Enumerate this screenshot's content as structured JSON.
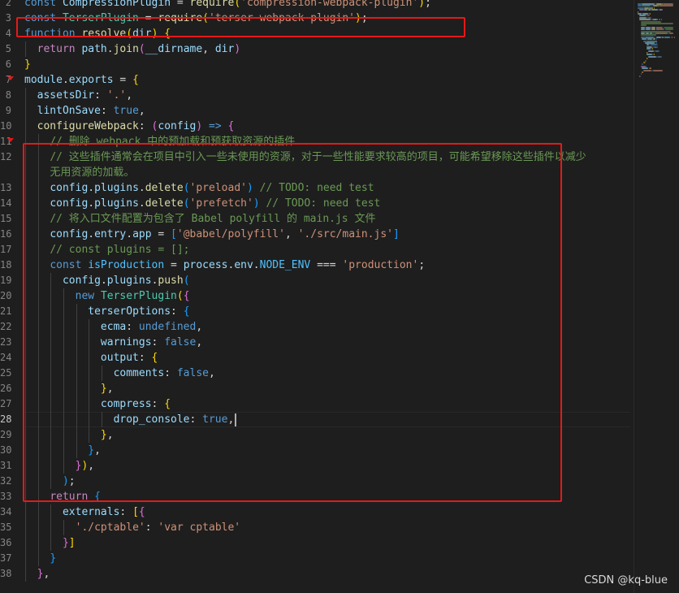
{
  "editor": {
    "lines": [
      {
        "n": "2",
        "tokens": [
          [
            "kw",
            "const "
          ],
          [
            "var",
            "CompressionPlugin"
          ],
          [
            "pl",
            " = "
          ],
          [
            "fn",
            "require"
          ],
          [
            "br1",
            "("
          ],
          [
            "str",
            "'compression-webpack-plugin'"
          ],
          [
            "br1",
            ")"
          ],
          [
            "pl",
            ";"
          ]
        ]
      },
      {
        "n": "3",
        "tokens": [
          [
            "kw",
            "const "
          ],
          [
            "cls",
            "TerserPlugin"
          ],
          [
            "pl",
            " = "
          ],
          [
            "fn",
            "require"
          ],
          [
            "br1",
            "("
          ],
          [
            "str",
            "'terser-webpack-plugin'"
          ],
          [
            "br1",
            ")"
          ],
          [
            "pl",
            ";"
          ]
        ]
      },
      {
        "n": "4",
        "tokens": [
          [
            "kw",
            "function "
          ],
          [
            "fn",
            "resolve"
          ],
          [
            "br1",
            "("
          ],
          [
            "var",
            "dir"
          ],
          [
            "br1",
            ")"
          ],
          [
            "pl",
            " "
          ],
          [
            "br1",
            "{"
          ]
        ]
      },
      {
        "n": "5",
        "tokens": [
          [
            "pl",
            "  "
          ],
          [
            "ctl",
            "return "
          ],
          [
            "var",
            "path"
          ],
          [
            "pl",
            "."
          ],
          [
            "fn",
            "join"
          ],
          [
            "br2",
            "("
          ],
          [
            "var",
            "__dirname"
          ],
          [
            "pl",
            ", "
          ],
          [
            "var",
            "dir"
          ],
          [
            "br2",
            ")"
          ]
        ]
      },
      {
        "n": "6",
        "tokens": [
          [
            "br1",
            "}"
          ]
        ]
      },
      {
        "n": "7",
        "tokens": [
          [
            "var",
            "module"
          ],
          [
            "pl",
            "."
          ],
          [
            "var",
            "exports"
          ],
          [
            "pl",
            " = "
          ],
          [
            "br1",
            "{"
          ]
        ]
      },
      {
        "n": "8",
        "tokens": [
          [
            "pl",
            "  "
          ],
          [
            "var",
            "assetsDir"
          ],
          [
            "pl",
            ": "
          ],
          [
            "str",
            "'.'"
          ],
          [
            "pl",
            ","
          ]
        ]
      },
      {
        "n": "9",
        "tokens": [
          [
            "pl",
            "  "
          ],
          [
            "var",
            "lintOnSave"
          ],
          [
            "pl",
            ": "
          ],
          [
            "kw",
            "true"
          ],
          [
            "pl",
            ","
          ]
        ]
      },
      {
        "n": "10",
        "tokens": [
          [
            "pl",
            "  "
          ],
          [
            "fn",
            "configureWebpack"
          ],
          [
            "pl",
            ": "
          ],
          [
            "br2",
            "("
          ],
          [
            "var",
            "config"
          ],
          [
            "br2",
            ")"
          ],
          [
            "pl",
            " "
          ],
          [
            "kw",
            "=>"
          ],
          [
            "pl",
            " "
          ],
          [
            "br2",
            "{"
          ]
        ]
      },
      {
        "n": "11",
        "tokens": [
          [
            "pl",
            "    "
          ],
          [
            "com",
            "// 删除 webpack 中的预加载和预获取资源的插件"
          ]
        ]
      },
      {
        "n": "12",
        "tokens": [
          [
            "pl",
            "    "
          ],
          [
            "com",
            "// 这些插件通常会在项目中引入一些未使用的资源，对于一些性能要求较高的项目，可能希望移除这些插件以减少"
          ]
        ]
      },
      {
        "n": "",
        "tokens": [
          [
            "pl",
            "    "
          ],
          [
            "com",
            "无用资源的加载。"
          ]
        ]
      },
      {
        "n": "13",
        "tokens": [
          [
            "pl",
            "    "
          ],
          [
            "var",
            "config"
          ],
          [
            "pl",
            "."
          ],
          [
            "var",
            "plugins"
          ],
          [
            "pl",
            "."
          ],
          [
            "fn",
            "delete"
          ],
          [
            "br3",
            "("
          ],
          [
            "str",
            "'preload'"
          ],
          [
            "br3",
            ")"
          ],
          [
            "pl",
            " "
          ],
          [
            "com",
            "// TODO: need test"
          ]
        ]
      },
      {
        "n": "14",
        "tokens": [
          [
            "pl",
            "    "
          ],
          [
            "var",
            "config"
          ],
          [
            "pl",
            "."
          ],
          [
            "var",
            "plugins"
          ],
          [
            "pl",
            "."
          ],
          [
            "fn",
            "delete"
          ],
          [
            "br3",
            "("
          ],
          [
            "str",
            "'prefetch'"
          ],
          [
            "br3",
            ")"
          ],
          [
            "pl",
            " "
          ],
          [
            "com",
            "// TODO: need test"
          ]
        ]
      },
      {
        "n": "15",
        "tokens": [
          [
            "pl",
            "    "
          ],
          [
            "com",
            "// 将入口文件配置为包含了 Babel polyfill 的 main.js 文件"
          ]
        ]
      },
      {
        "n": "16",
        "tokens": [
          [
            "pl",
            "    "
          ],
          [
            "var",
            "config"
          ],
          [
            "pl",
            "."
          ],
          [
            "var",
            "entry"
          ],
          [
            "pl",
            "."
          ],
          [
            "var",
            "app"
          ],
          [
            "pl",
            " = "
          ],
          [
            "br3",
            "["
          ],
          [
            "str",
            "'@babel/polyfill'"
          ],
          [
            "pl",
            ", "
          ],
          [
            "str",
            "'./src/main.js'"
          ],
          [
            "br3",
            "]"
          ]
        ]
      },
      {
        "n": "17",
        "tokens": [
          [
            "pl",
            "    "
          ],
          [
            "com",
            "// const plugins = [];"
          ]
        ]
      },
      {
        "n": "18",
        "tokens": [
          [
            "pl",
            "    "
          ],
          [
            "kw",
            "const "
          ],
          [
            "const",
            "isProduction"
          ],
          [
            "pl",
            " = "
          ],
          [
            "var",
            "process"
          ],
          [
            "pl",
            "."
          ],
          [
            "var",
            "env"
          ],
          [
            "pl",
            "."
          ],
          [
            "const",
            "NODE_ENV"
          ],
          [
            "pl",
            " === "
          ],
          [
            "str",
            "'production'"
          ],
          [
            "pl",
            ";"
          ]
        ]
      },
      {
        "n": "19",
        "tokens": [
          [
            "pl",
            "      "
          ],
          [
            "var",
            "config"
          ],
          [
            "pl",
            "."
          ],
          [
            "var",
            "plugins"
          ],
          [
            "pl",
            "."
          ],
          [
            "fn",
            "push"
          ],
          [
            "br3",
            "("
          ]
        ]
      },
      {
        "n": "20",
        "tokens": [
          [
            "pl",
            "        "
          ],
          [
            "kw",
            "new "
          ],
          [
            "cls",
            "TerserPlugin"
          ],
          [
            "br1",
            "("
          ],
          [
            "br2",
            "{"
          ]
        ]
      },
      {
        "n": "21",
        "tokens": [
          [
            "pl",
            "          "
          ],
          [
            "var",
            "terserOptions"
          ],
          [
            "pl",
            ": "
          ],
          [
            "br3",
            "{"
          ]
        ]
      },
      {
        "n": "22",
        "tokens": [
          [
            "pl",
            "            "
          ],
          [
            "var",
            "ecma"
          ],
          [
            "pl",
            ": "
          ],
          [
            "kw",
            "undefined"
          ],
          [
            "pl",
            ","
          ]
        ]
      },
      {
        "n": "23",
        "tokens": [
          [
            "pl",
            "            "
          ],
          [
            "var",
            "warnings"
          ],
          [
            "pl",
            ": "
          ],
          [
            "kw",
            "false"
          ],
          [
            "pl",
            ","
          ]
        ]
      },
      {
        "n": "24",
        "tokens": [
          [
            "pl",
            "            "
          ],
          [
            "var",
            "output"
          ],
          [
            "pl",
            ": "
          ],
          [
            "br1",
            "{"
          ]
        ]
      },
      {
        "n": "25",
        "tokens": [
          [
            "pl",
            "              "
          ],
          [
            "var",
            "comments"
          ],
          [
            "pl",
            ": "
          ],
          [
            "kw",
            "false"
          ],
          [
            "pl",
            ","
          ]
        ]
      },
      {
        "n": "26",
        "tokens": [
          [
            "pl",
            "            "
          ],
          [
            "br1",
            "}"
          ],
          [
            "pl",
            ","
          ]
        ]
      },
      {
        "n": "27",
        "tokens": [
          [
            "pl",
            "            "
          ],
          [
            "var",
            "compress"
          ],
          [
            "pl",
            ": "
          ],
          [
            "br1",
            "{"
          ]
        ]
      },
      {
        "n": "28",
        "active": true,
        "caret": true,
        "tokens": [
          [
            "pl",
            "              "
          ],
          [
            "var",
            "drop_console"
          ],
          [
            "pl",
            ": "
          ],
          [
            "kw",
            "true"
          ],
          [
            "pl",
            ","
          ]
        ]
      },
      {
        "n": "29",
        "tokens": [
          [
            "pl",
            "            "
          ],
          [
            "br1",
            "}"
          ],
          [
            "pl",
            ","
          ]
        ]
      },
      {
        "n": "30",
        "tokens": [
          [
            "pl",
            "          "
          ],
          [
            "br3",
            "}"
          ],
          [
            "pl",
            ","
          ]
        ]
      },
      {
        "n": "31",
        "tokens": [
          [
            "pl",
            "        "
          ],
          [
            "br2",
            "}"
          ],
          [
            "br1",
            ")"
          ],
          [
            "pl",
            ","
          ]
        ]
      },
      {
        "n": "32",
        "tokens": [
          [
            "pl",
            "      "
          ],
          [
            "br3",
            ")"
          ],
          [
            "pl",
            ";"
          ]
        ]
      },
      {
        "n": "33",
        "tokens": [
          [
            "pl",
            "    "
          ],
          [
            "ctl",
            "return "
          ],
          [
            "br3",
            "{"
          ]
        ]
      },
      {
        "n": "34",
        "tokens": [
          [
            "pl",
            "      "
          ],
          [
            "var",
            "externals"
          ],
          [
            "pl",
            ": "
          ],
          [
            "br1",
            "["
          ],
          [
            "br2",
            "{"
          ]
        ]
      },
      {
        "n": "35",
        "tokens": [
          [
            "pl",
            "        "
          ],
          [
            "str",
            "'./cptable'"
          ],
          [
            "pl",
            ": "
          ],
          [
            "str",
            "'var cptable'"
          ]
        ]
      },
      {
        "n": "36",
        "tokens": [
          [
            "pl",
            "      "
          ],
          [
            "br2",
            "}"
          ],
          [
            "br1",
            "]"
          ]
        ]
      },
      {
        "n": "37",
        "tokens": [
          [
            "pl",
            "    "
          ],
          [
            "br3",
            "}"
          ]
        ]
      },
      {
        "n": "38",
        "tokens": [
          [
            "pl",
            "  "
          ],
          [
            "br2",
            "}"
          ],
          [
            "pl",
            ","
          ]
        ]
      }
    ]
  },
  "watermark": "CSDN @kq-blue",
  "colors": {
    "highlight_box": "#e51919",
    "background": "#1e1e1e"
  }
}
